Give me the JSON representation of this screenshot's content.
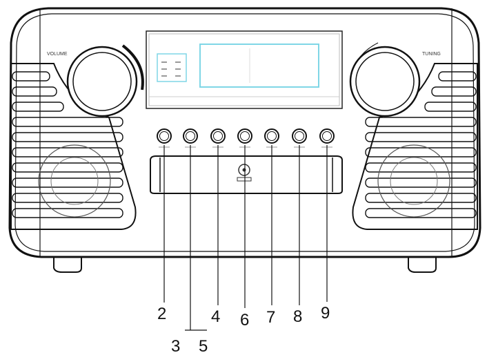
{
  "panel_labels": {
    "volume": "VOLUME",
    "tuning": "TUNING"
  },
  "buttons": [
    {
      "id": "btn-1"
    },
    {
      "id": "btn-2"
    },
    {
      "id": "btn-3"
    },
    {
      "id": "btn-4"
    },
    {
      "id": "btn-5"
    },
    {
      "id": "btn-6"
    },
    {
      "id": "btn-7"
    }
  ],
  "callouts": {
    "n2": "2",
    "n3": "3",
    "n4": "4",
    "n5": "5",
    "n6": "6",
    "n7": "7",
    "n8": "8",
    "n9": "9"
  },
  "icons": [
    "cd-logo-icon",
    "volume-knob",
    "tuning-knob",
    "speaker-grille"
  ],
  "colors": {
    "line": "#111111",
    "display": "#7fd6e6",
    "background": "#ffffff"
  }
}
